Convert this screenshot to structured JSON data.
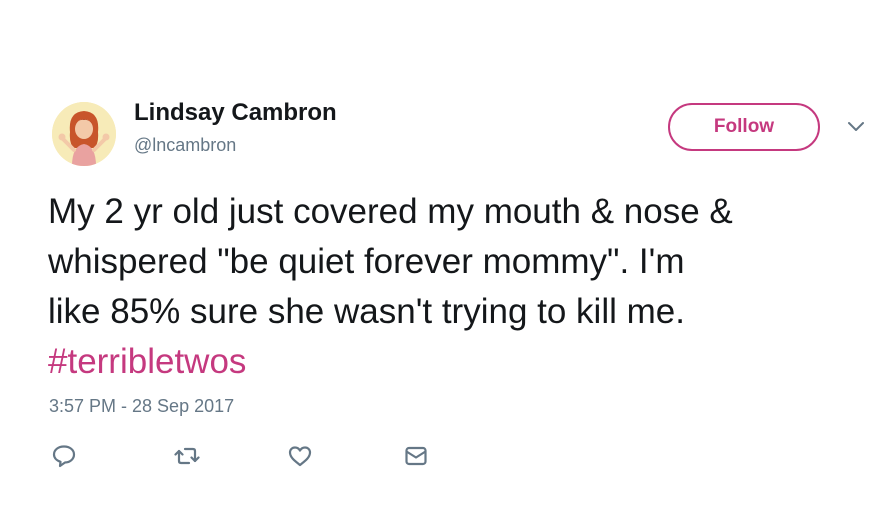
{
  "author": {
    "name": "Lindsay Cambron",
    "handle": "@lncambron"
  },
  "follow_button": {
    "label": "Follow"
  },
  "tweet": {
    "lines": [
      "My 2 yr old just covered my mouth & nose &",
      "whispered \"be quiet forever mommy\". I'm",
      "like 85% sure she wasn't trying to kill me."
    ],
    "hashtag": "#terribletwos",
    "timestamp": "3:57 PM - 28 Sep 2017"
  },
  "actions": [
    "reply-icon",
    "retweet-icon",
    "like-icon",
    "message-icon"
  ],
  "colors": {
    "accent": "#c5397f",
    "text": "#14171a",
    "secondary": "#657786"
  }
}
